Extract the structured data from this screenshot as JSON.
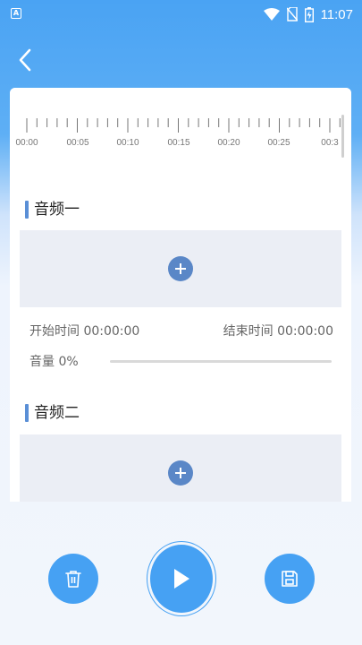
{
  "status_bar": {
    "time": "11:07",
    "icons": [
      "notification-a-icon",
      "wifi-icon",
      "no-sim-icon",
      "battery-charging-icon"
    ]
  },
  "colors": {
    "primary": "#46a1f3",
    "section_accent": "#5a8fd6",
    "add_button": "#5a87c7",
    "drop_zone": "#ebeef5"
  },
  "timeline": {
    "labels": [
      "00:00",
      "00:05",
      "00:10",
      "00:15",
      "00:20",
      "00:25",
      "00:3"
    ]
  },
  "tracks": [
    {
      "title": "音频一",
      "start_time": "开始时间 00:00:00",
      "end_time": "结束时间 00:00:00",
      "volume": "音量 0%",
      "volume_value": 0
    },
    {
      "title": "音频二"
    }
  ],
  "controls": {
    "left": "delete-icon",
    "center": "play-icon",
    "right": "save-icon"
  }
}
